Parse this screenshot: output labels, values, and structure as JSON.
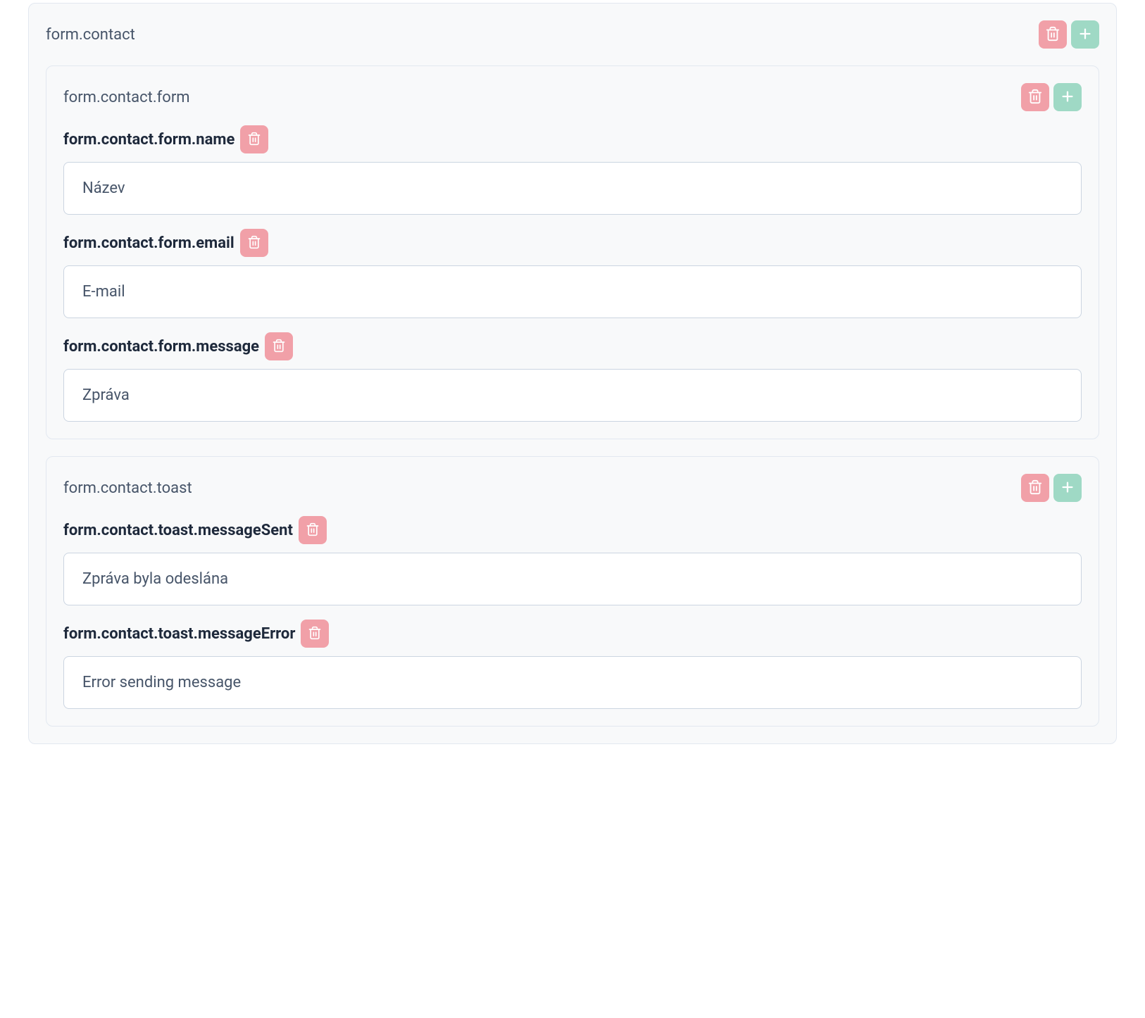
{
  "sections": {
    "contact": {
      "title": "form.contact",
      "subsections": {
        "form": {
          "title": "form.contact.form",
          "fields": {
            "name": {
              "label": "form.contact.form.name",
              "value": "Název"
            },
            "email": {
              "label": "form.contact.form.email",
              "value": "E-mail"
            },
            "message": {
              "label": "form.contact.form.message",
              "value": "Zpráva"
            }
          }
        },
        "toast": {
          "title": "form.contact.toast",
          "fields": {
            "messageSent": {
              "label": "form.contact.toast.messageSent",
              "value": "Zpráva byla odeslána"
            },
            "messageError": {
              "label": "form.contact.toast.messageError",
              "value": "Error sending message"
            }
          }
        }
      }
    }
  }
}
